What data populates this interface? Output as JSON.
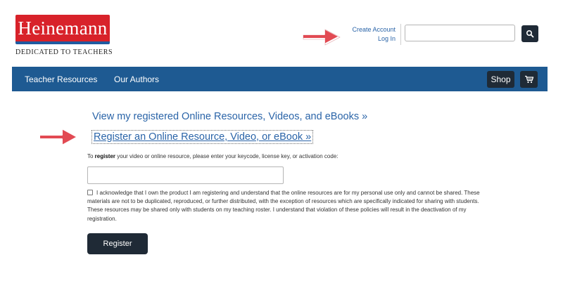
{
  "brand": {
    "logo_text": "Heinemann",
    "tagline": "Dedicated to Teachers",
    "colors": {
      "logo_red": "#d8222a",
      "logo_blue": "#1f5aa0",
      "nav_blue": "#1e5a92",
      "dark_button": "#1f2a36",
      "link_blue": "#2a64a8",
      "arrow_red": "#e24a53"
    }
  },
  "header": {
    "create_account": "Create Account",
    "log_in": "Log In",
    "search": {
      "value": "",
      "placeholder": "",
      "button_icon": "search-icon"
    }
  },
  "nav": {
    "items": [
      {
        "label": "Teacher Resources"
      },
      {
        "label": "Our Authors"
      }
    ],
    "shop_label": "Shop",
    "cart_icon": "cart-icon"
  },
  "main": {
    "view_link": "View my registered Online Resources, Videos, and eBooks »",
    "register_link": "Register an Online Resource, Video, or eBook »",
    "instruction_pre": "To ",
    "instruction_bold": "register",
    "instruction_post": " your video or online resource, please enter your keycode, license key, or activation code:",
    "keycode": {
      "value": "",
      "placeholder": ""
    },
    "acknowledge_checked": false,
    "acknowledge_text": "I acknowledge that I own the product I am registering and understand that the online resources are for my personal use only and cannot be shared. These materials are not to be duplicated, reproduced, or further distributed, with the exception of resources which are specifically indicated for sharing with students. These resources may be shared only with students on my teaching roster. I understand that violation of these policies will result in the deactivation of my registration.",
    "register_button": "Register"
  }
}
